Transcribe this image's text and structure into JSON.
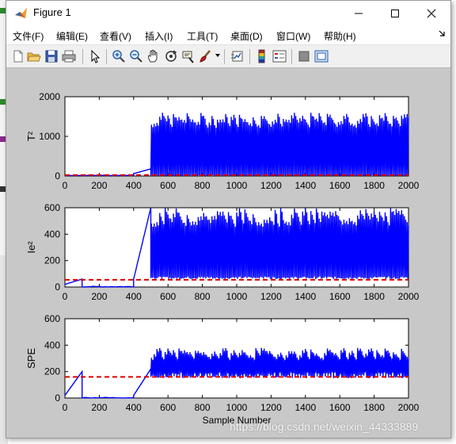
{
  "window": {
    "title": "Figure 1"
  },
  "menu": [
    {
      "label": "文件(F)"
    },
    {
      "label": "编辑(E)"
    },
    {
      "label": "查看(V)"
    },
    {
      "label": "插入(I)"
    },
    {
      "label": "工具(T)"
    },
    {
      "label": "桌面(D)"
    },
    {
      "label": "窗口(W)"
    },
    {
      "label": "帮助(H)"
    }
  ],
  "toolbar": [
    "new-figure",
    "open-file",
    "save",
    "print",
    "edit-plot-arrow",
    "zoom-in",
    "zoom-out",
    "pan-hand",
    "rotate-3d",
    "data-cursor",
    "brush",
    "link-plot",
    "colorbar",
    "legend",
    "hide-plot-tools",
    "show-plot-tools"
  ],
  "colors": {
    "series": "#0000ff",
    "threshold": "#dd0000",
    "axes_bg": "#ffffff",
    "figure_bg": "#c8c8c8"
  },
  "watermark": "https://blog.csdn.net/weixin_44333889",
  "chart_data": [
    {
      "type": "line",
      "ylabel": "T²",
      "xlabel": "",
      "xlim": [
        0,
        2000
      ],
      "ylim": [
        0,
        2000
      ],
      "xticks": [
        "0",
        "200",
        "400",
        "600",
        "800",
        "1000",
        "1200",
        "1400",
        "1600",
        "1800",
        "2000"
      ],
      "yticks": [
        "0",
        "1000",
        "2000"
      ],
      "threshold": 25,
      "series": [
        {
          "segments": [
            {
              "x0": 0,
              "x1": 400,
              "low": 10,
              "high": 20
            },
            {
              "x0": 400,
              "x1": 500,
              "low": 60,
              "high": 180
            },
            {
              "x0": 500,
              "x1": 2000,
              "low": 0,
              "high": 1600,
              "spike_period": 16
            }
          ]
        }
      ]
    },
    {
      "type": "line",
      "ylabel": "Ie²",
      "xlabel": "",
      "xlim": [
        0,
        2000
      ],
      "ylim": [
        0,
        600
      ],
      "xticks": [
        "0",
        "200",
        "400",
        "600",
        "800",
        "1000",
        "1200",
        "1400",
        "1600",
        "1800",
        "2000"
      ],
      "yticks": [
        "0",
        "200",
        "400",
        "600"
      ],
      "threshold": 55,
      "series": [
        {
          "segments": [
            {
              "x0": 0,
              "x1": 100,
              "low": 20,
              "high": 60
            },
            {
              "x0": 100,
              "x1": 400,
              "low": 0,
              "high": 5
            },
            {
              "x0": 400,
              "x1": 500,
              "low": 60,
              "high": 600
            },
            {
              "x0": 500,
              "x1": 2000,
              "low": 60,
              "high": 600,
              "spike_period": 16
            }
          ]
        }
      ]
    },
    {
      "type": "line",
      "ylabel": "SPE",
      "xlabel": "Sample Number",
      "xlim": [
        0,
        2000
      ],
      "ylim": [
        0,
        600
      ],
      "xticks": [
        "0",
        "200",
        "400",
        "600",
        "800",
        "1000",
        "1200",
        "1400",
        "1600",
        "1800",
        "2000"
      ],
      "yticks": [
        "0",
        "200",
        "400",
        "600"
      ],
      "threshold": 160,
      "series": [
        {
          "segments": [
            {
              "x0": 0,
              "x1": 100,
              "low": 20,
              "high": 200
            },
            {
              "x0": 100,
              "x1": 400,
              "low": 0,
              "high": 5
            },
            {
              "x0": 400,
              "x1": 500,
              "low": 20,
              "high": 220
            },
            {
              "x0": 500,
              "x1": 2000,
              "low": 150,
              "high": 380,
              "spike_period": 16
            }
          ]
        }
      ]
    }
  ]
}
